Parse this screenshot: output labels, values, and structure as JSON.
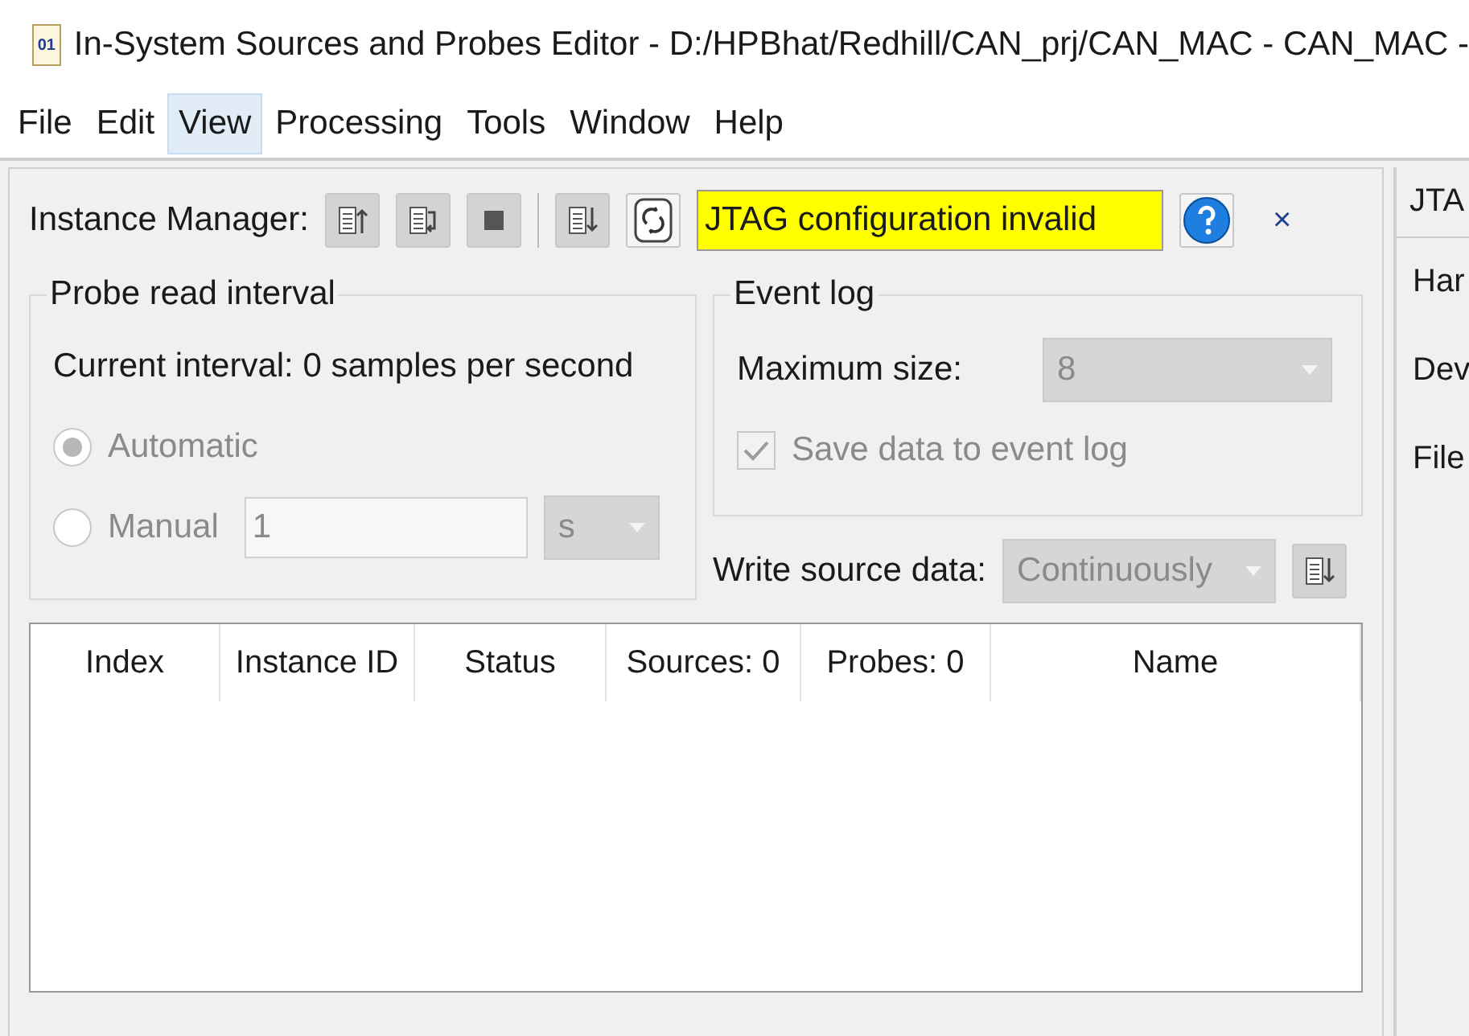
{
  "window": {
    "title": "In-System Sources and Probes Editor - D:/HPBhat/Redhill/CAN_prj/CAN_MAC - CAN_MAC -",
    "icon_text": "01"
  },
  "menu": [
    {
      "label": "File",
      "selected": false
    },
    {
      "label": "Edit",
      "selected": false
    },
    {
      "label": "View",
      "selected": true
    },
    {
      "label": "Processing",
      "selected": false
    },
    {
      "label": "Tools",
      "selected": false
    },
    {
      "label": "Window",
      "selected": false
    },
    {
      "label": "Help",
      "selected": false
    }
  ],
  "instance_manager": {
    "label": "Instance Manager:",
    "status": "JTAG configuration invalid",
    "close": "×"
  },
  "probe_read_interval": {
    "title": "Probe read interval",
    "current": "Current interval:  0 samples per second",
    "options": [
      {
        "label": "Automatic",
        "selected": true,
        "disabled": true
      },
      {
        "label": "Manual",
        "selected": false,
        "disabled": true
      }
    ],
    "manual_value": "1",
    "unit": "s"
  },
  "event_log": {
    "title": "Event log",
    "max_size_label": "Maximum size:",
    "max_size": "8",
    "save": {
      "label": "Save data to event log",
      "checked": true,
      "disabled": true
    }
  },
  "write_source": {
    "label": "Write source data:",
    "value": "Continuously"
  },
  "table": {
    "columns": [
      "Index",
      "Instance ID",
      "Status",
      "Sources: 0",
      "Probes: 0",
      "Name"
    ]
  },
  "right_panel": {
    "header": "JTA",
    "items": [
      "Har",
      "Dev",
      "File"
    ]
  }
}
